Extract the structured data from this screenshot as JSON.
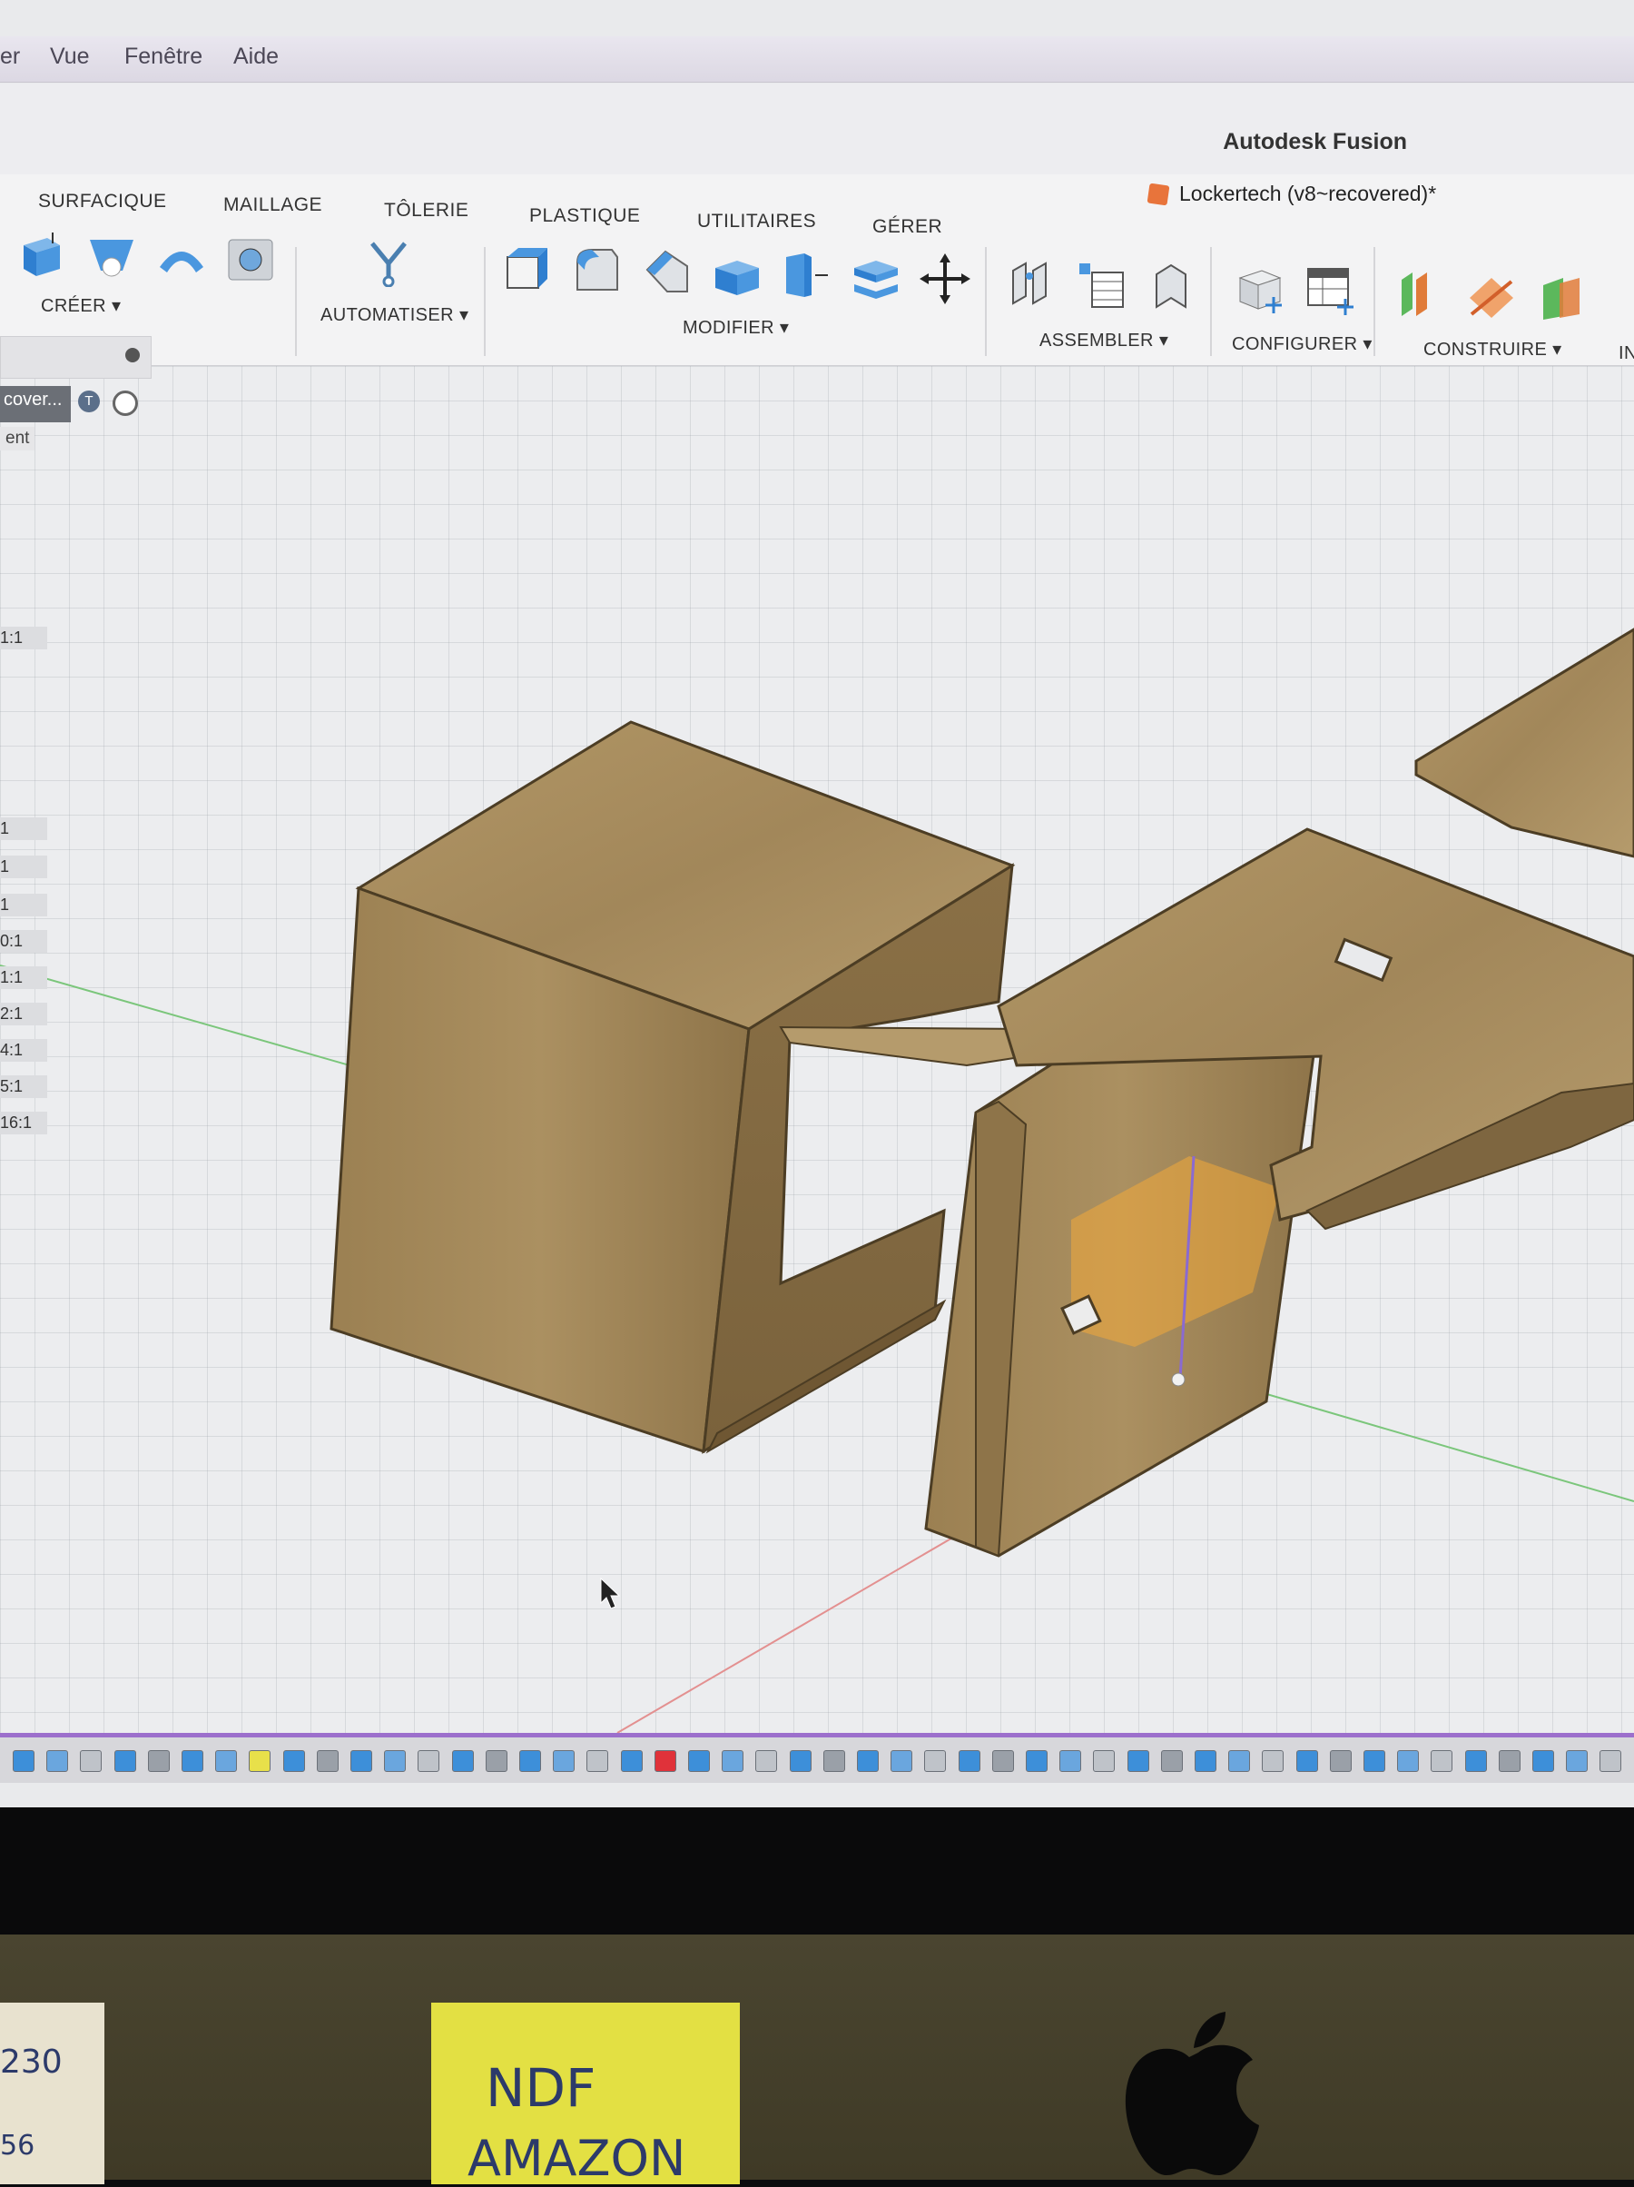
{
  "menubar": {
    "items": [
      "er",
      "Vue",
      "Fenêtre",
      "Aide"
    ]
  },
  "app": {
    "title": "Autodesk Fusion"
  },
  "document": {
    "tab_label": "Lockertech (v8~recovered)*",
    "icon_color": "#e8743b"
  },
  "toolbar": {
    "tabs": [
      "SURFACIQUE",
      "MAILLAGE",
      "TÔLERIE",
      "PLASTIQUE",
      "UTILITAIRES",
      "GÉRER"
    ],
    "groups": [
      "CRÉER ▾",
      "AUTOMATISER ▾",
      "MODIFIER ▾",
      "ASSEMBLER ▾",
      "CONFIGURER ▾",
      "CONSTRUIRE ▾",
      "IN"
    ]
  },
  "browser": {
    "item_label": "cover...",
    "sub_label": "ent",
    "ratios": [
      "1:1",
      "",
      "",
      "",
      "",
      "",
      "1",
      "1",
      "1",
      "0:1",
      "1:1",
      "2:1",
      "4:1",
      "5:1",
      "16:1"
    ]
  },
  "accent_colors": {
    "tool_blue": "#3d8fd9",
    "timeline_border": "#9c6fcc",
    "wood": "#a88d5a"
  },
  "sticky_notes": [
    "230",
    "56",
    "NDF",
    "AMAZON"
  ]
}
